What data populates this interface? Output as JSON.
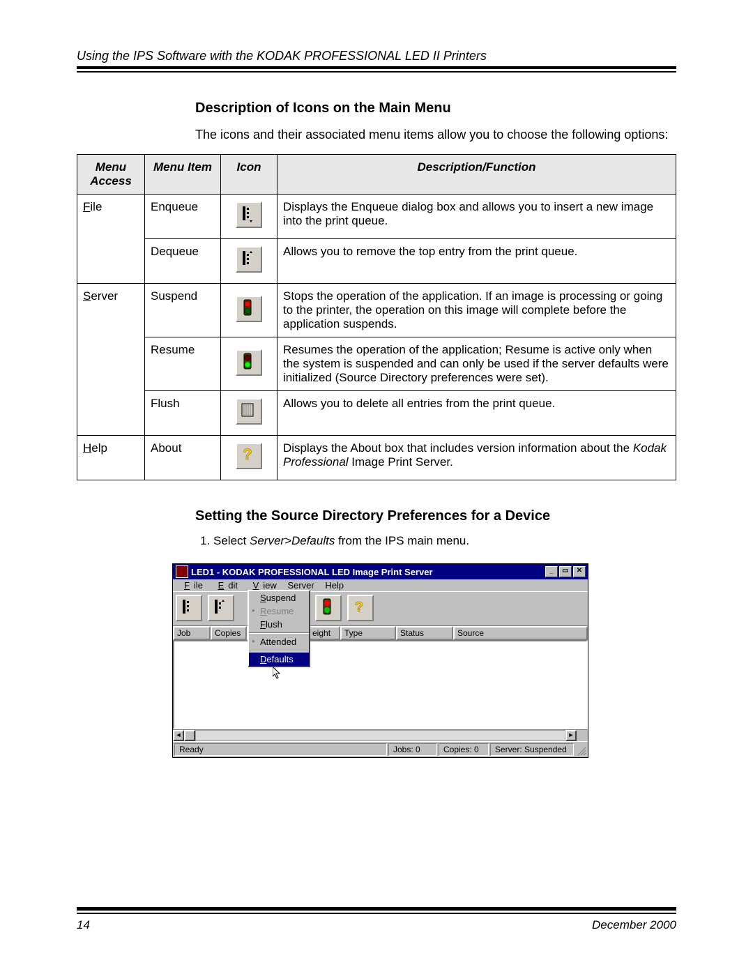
{
  "header": {
    "title": "Using the IPS Software with the KODAK PROFESSIONAL LED II Printers"
  },
  "section1": {
    "heading": "Description of Icons on the Main Menu",
    "intro": "The icons and their associated menu items allow you to choose the following options:"
  },
  "table": {
    "headers": {
      "access": "Menu Access",
      "item": "Menu Item",
      "icon": "Icon",
      "desc": "Description/Function"
    },
    "rows": [
      {
        "access_pre": "F",
        "access_post": "ile",
        "item": "Enqueue",
        "icon": "enqueue-icon",
        "desc": "Displays the Enqueue dialog box and allows you to insert a new image into the print queue."
      },
      {
        "access_pre": "",
        "access_post": "",
        "item": "Dequeue",
        "icon": "dequeue-icon",
        "desc": "Allows you to remove the top entry from the print queue."
      },
      {
        "access_pre": "S",
        "access_post": "erver",
        "item": "Suspend",
        "icon": "suspend-icon",
        "desc": "Stops the operation of the application. If an image is processing or going to the printer, the operation on this image will complete before the application suspends."
      },
      {
        "access_pre": "",
        "access_post": "",
        "item": "Resume",
        "icon": "resume-icon",
        "desc": "Resumes the operation of the application; Resume is active only when the system is suspended and can only be used if the server defaults were initialized (Source Directory preferences were set)."
      },
      {
        "access_pre": "",
        "access_post": "",
        "item": "Flush",
        "icon": "flush-icon",
        "desc": "Allows you to delete all entries from the print queue."
      },
      {
        "access_pre": "H",
        "access_post": "elp",
        "item": "About",
        "icon": "about-icon",
        "desc_pre": "Displays the About box that includes version information about the ",
        "desc_em": "Kodak Professional",
        "desc_post": " Image Print Server."
      }
    ]
  },
  "section2": {
    "heading": "Setting the Source Directory Preferences for a Device",
    "step1_pre": "Select ",
    "step1_em": "Server>Defaults",
    "step1_post": " from the IPS main menu."
  },
  "screenshot": {
    "title": "LED1 - KODAK PROFESSIONAL LED Image Print Server",
    "winbtn_min": "_",
    "winbtn_max": "▭",
    "winbtn_close": "✕",
    "menus": {
      "file": "File",
      "file_u": "F",
      "edit": "Edit",
      "edit_u": "E",
      "view": "View",
      "view_u": "V",
      "server": "Server",
      "help": "Help"
    },
    "server_menu": {
      "suspend": "Suspend",
      "suspend_u": "S",
      "resume": "Resume",
      "resume_u": "R",
      "flush": "Flush",
      "flush_u": "F",
      "attended": "Attended",
      "defaults": "Defaults",
      "defaults_u": "D"
    },
    "cols": {
      "job": "Job",
      "copies": "Copies",
      "height": "eight",
      "type": "Type",
      "status": "Status",
      "source": "Source"
    },
    "status": {
      "ready": "Ready",
      "jobs": "Jobs:   0",
      "copies": "Copies:  0",
      "server": "Server: Suspended"
    },
    "scroll_left": "◄",
    "scroll_right": "►"
  },
  "footer": {
    "page": "14",
    "date": "December 2000"
  }
}
